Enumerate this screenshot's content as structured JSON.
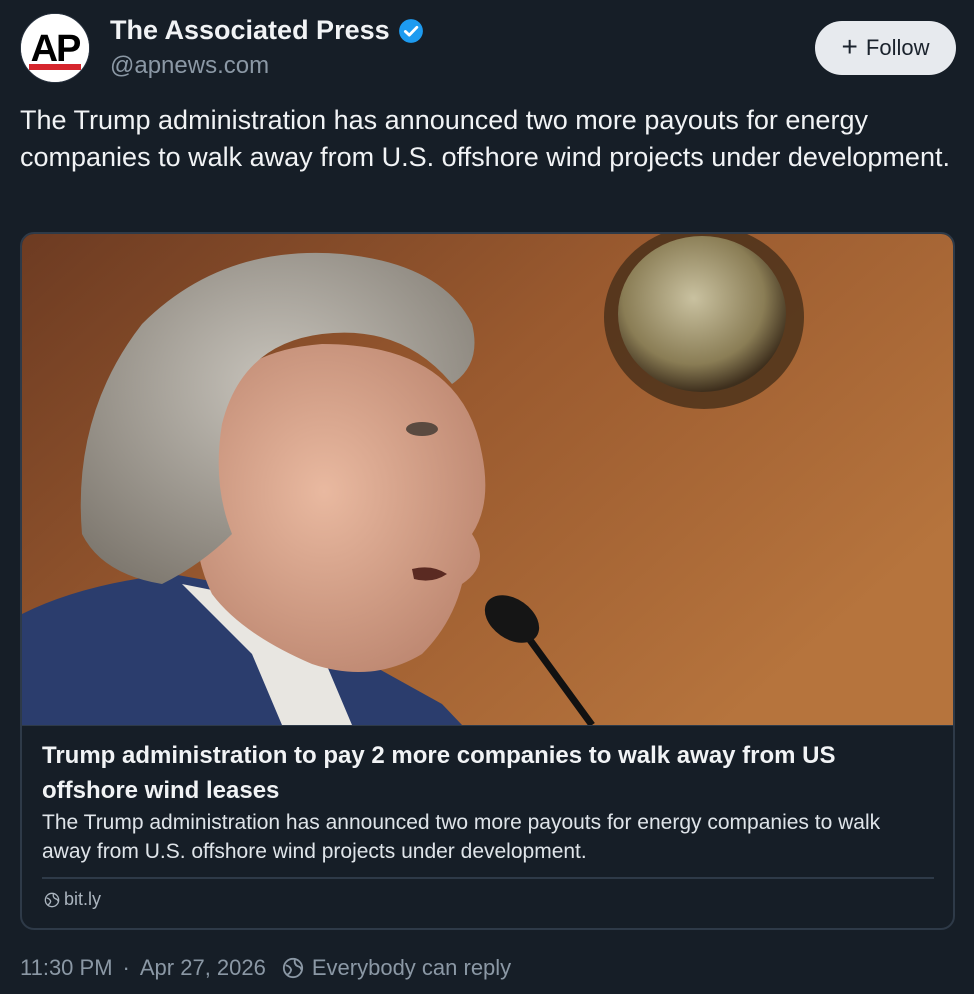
{
  "author": {
    "name": "The Associated Press",
    "handle": "@apnews.com",
    "avatar_text": "AP",
    "verified": true
  },
  "follow_button": {
    "icon": "plus-icon",
    "label": "Follow"
  },
  "post": {
    "text": "The Trump administration has announced two more payouts for energy companies to walk away from U.S. offshore wind projects under development."
  },
  "link_card": {
    "title": "Trump administration to pay 2 more companies to walk away from US offshore wind leases",
    "description": "The Trump administration has announced two more payouts for energy companies to walk away from U.S. offshore wind projects under development.",
    "domain": "bit.ly"
  },
  "meta": {
    "time": "11:30 PM",
    "separator": "·",
    "date": "Apr 27, 2026",
    "reply_setting": "Everybody can reply"
  },
  "colors": {
    "background": "#161e27",
    "verified_badge": "#1d9bf0",
    "follow_button_bg": "#e7eaee",
    "muted_text": "#8b98a5"
  }
}
